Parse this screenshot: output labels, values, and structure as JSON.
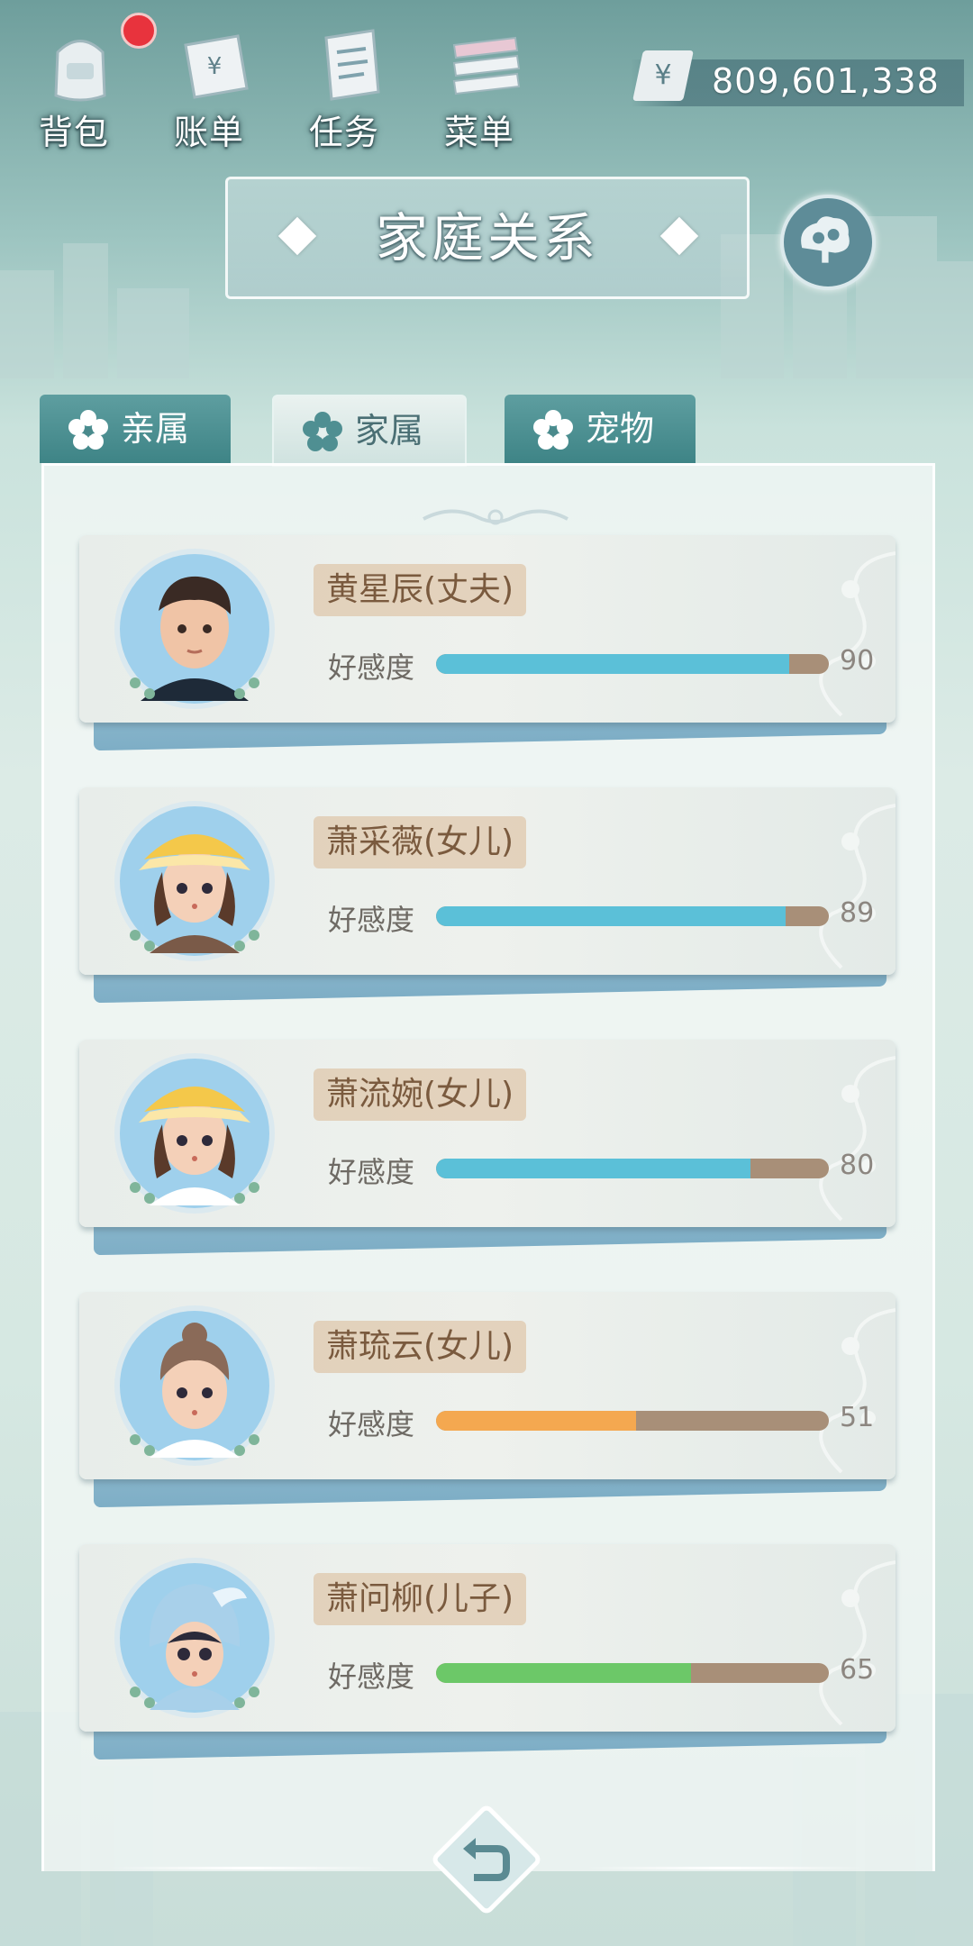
{
  "nav": [
    {
      "label": "背包",
      "icon": "backpack-icon",
      "has_badge": true
    },
    {
      "label": "账单",
      "icon": "bill-icon"
    },
    {
      "label": "任务",
      "icon": "task-icon"
    },
    {
      "label": "菜单",
      "icon": "menu-icon"
    }
  ],
  "currency": {
    "symbol": "¥",
    "amount": "809,601,338"
  },
  "header": {
    "title": "家庭关系",
    "family_button_icon": "family-tree-icon"
  },
  "tabs": [
    {
      "label": "亲属",
      "icon": "flower-icon",
      "active": false
    },
    {
      "label": "家属",
      "icon": "flower-icon",
      "active": true
    },
    {
      "label": "宠物",
      "icon": "flower-icon",
      "active": false
    }
  ],
  "affinity_label": "好感度",
  "members": [
    {
      "name": "黄星辰(丈夫)",
      "affinity": 90,
      "bar_color": "#5bc0d8"
    },
    {
      "name": "萧采薇(女儿)",
      "affinity": 89,
      "bar_color": "#5bc0d8"
    },
    {
      "name": "萧流婉(女儿)",
      "affinity": 80,
      "bar_color": "#5bc0d8"
    },
    {
      "name": "萧琉云(女儿)",
      "affinity": 51,
      "bar_color": "#f4a850"
    },
    {
      "name": "萧问柳(儿子)",
      "affinity": 65,
      "bar_color": "#6cc868"
    }
  ],
  "back_button_icon": "return-arrow-icon"
}
